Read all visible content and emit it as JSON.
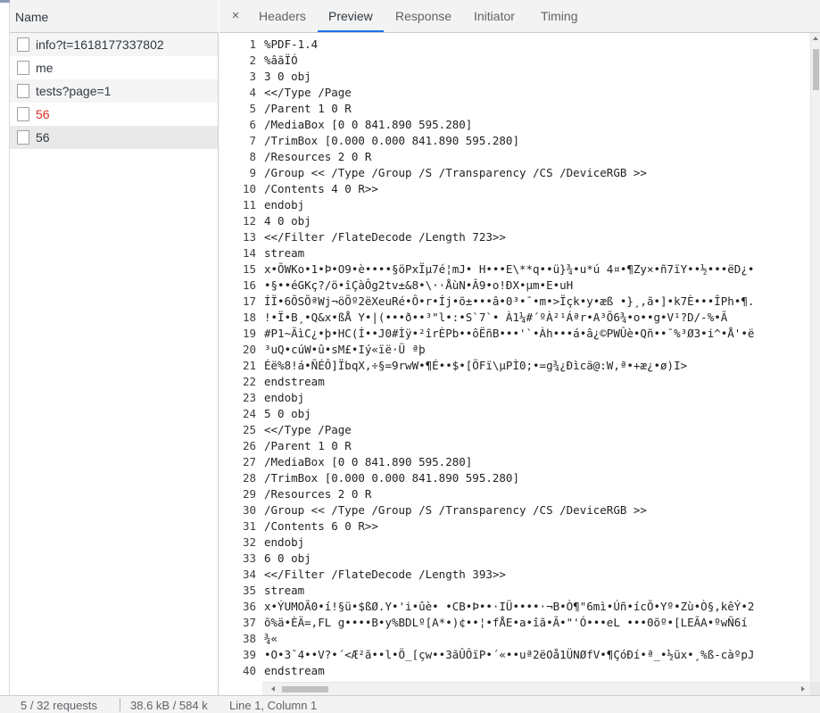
{
  "name_column_header": "Name",
  "requests": [
    {
      "name": "info?t=1618177337802",
      "error": false
    },
    {
      "name": "me",
      "error": false
    },
    {
      "name": "tests?page=1",
      "error": false
    },
    {
      "name": "56",
      "error": true
    },
    {
      "name": "56",
      "error": false,
      "selected": true
    }
  ],
  "tabs": [
    {
      "label": "Headers",
      "active": false
    },
    {
      "label": "Preview",
      "active": true
    },
    {
      "label": "Response",
      "active": false
    },
    {
      "label": "Initiator",
      "active": false
    },
    {
      "label": "Timing",
      "active": false
    }
  ],
  "close_glyph": "×",
  "status": {
    "requests": "5 / 32 requests",
    "transferred": "38.6 kB / 584 k",
    "cursor": "Line 1, Column 1"
  },
  "lines": [
    "%PDF-1.4",
    "%âãÏÓ",
    "3 0 obj",
    "<</Type /Page",
    "/Parent 1 0 R",
    "/MediaBox [0 0 841.890 595.280]",
    "/TrimBox [0.000 0.000 841.890 595.280]",
    "/Resources 2 0 R",
    "/Group << /Type /Group /S /Transparency /CS /DeviceRGB >>",
    "/Contents 4 0 R>>",
    "endobj",
    "4 0 obj",
    "<</Filter /FlateDecode /Length 723>>",
    "stream",
    "x•ÕWKo•1•Þ•O9•è••••§öPxÏµ7é¦mJ• H•••E\\**q••ü}¾•u*ú 4¤•¶Zy×•ñ7ïY••½•••ëD¿•",
    "•§••éGKç?/ö•îÇàÔg2tv±&8•\\··ÅùN•Â9•o!ÐX•µm•E•uH",
    "ÍÏ•6ÕSÕªWj¬öÕº2ëXeuRé•Ô•r•Íj•õ±•••â•0³•¯•m•>Ïçk•y•æß •}¸,ã•]•k7È•••ÎPh•¶.",
    "!•Ï•B¸•Q&x•ßÅ Y•|(•••ð••³\"l•:•S`7`•     À1¼#´ºÀ²¹Áªr•A³Õ6¾•o••g•V¹?D/-%•Ã",
    "#P1~ÄìC¿•þ•HC(Í••J0#Ìÿ•²îrÈPb••ôËñB•••'`•Àh•••á•â¿©PWÛè•Qñ••¯%³Ø3•i^•Å'•ë",
    "³uQ•cúW•û•sM£•Iý«ïë·Ü ªþ",
    "Éë%8!á•ÑÉÔ]ÏbqX,÷§=9rwW•¶É••$•[ÖFï\\µPÌ0;•=g¾¿Ðìcä@:W,ª•+æ¿•ø)I>",
    "endstream",
    "endobj",
    "5 0 obj",
    "<</Type /Page",
    "/Parent 1 0 R",
    "/MediaBox [0 0 841.890 595.280]",
    "/TrimBox [0.000 0.000 841.890 595.280]",
    "/Resources 2 0 R",
    "/Group << /Type /Group /S /Transparency /CS /DeviceRGB >>",
    "/Contents 6 0 R>>",
    "endobj",
    "6 0 obj",
    "<</Filter /FlateDecode /Length 393>>",
    "stream",
    "x•ÝUMOÃ0•í!§ü•$ßØ.Y•'i•ûè•  •CB•Þ••·IÜ••••·¬B•Ò¶\"6mì•Úñ•ícÕ•Yº•Zù•Ò§,kêÝ•2",
    "õ%ä•ÈÄ=,FL g••••B•y%BDLº[A*•)¢••¦•fÅE•a•îã•Ã•\"'Ó•••eL •••0õº•[LEÃA•ºwÑ6í",
    "¾«",
    "•O•3¯4••V?•´<Æ²ã••l•Ö_[çw••3ãÛÔïP•´«••uª2ëOå1ÜNØfV•¶ÇóÐí•ª_•½üx•¸%ß-càºpJ",
    "endstream",
    ""
  ]
}
